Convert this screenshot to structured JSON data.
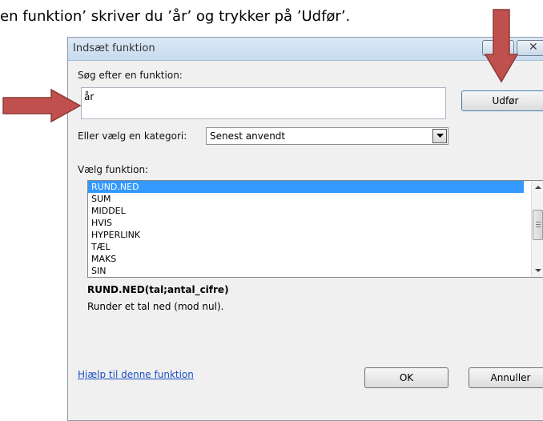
{
  "caption": "en funktion’ skriver du ’år’ og trykker på ’Udfør’.",
  "dialog": {
    "title": "Indsæt funktion",
    "search_label": "Søg efter en funktion:",
    "search_value": "år",
    "run_button": "Udfør",
    "category_label": "Eller vælg en kategori:",
    "category_value": "Senest anvendt",
    "function_list_label": "Vælg funktion:",
    "functions": [
      "RUND.NED",
      "SUM",
      "MIDDEL",
      "HVIS",
      "HYPERLINK",
      "TÆL",
      "MAKS",
      "SIN"
    ],
    "selected_function": "RUND.NED",
    "syntax": "RUND.NED(tal;antal_cifre)",
    "description": "Runder et tal ned (mod nul).",
    "help_link": "Hjælp til denne funktion",
    "ok_button": "OK",
    "cancel_button": "Annuller"
  },
  "arrows": {
    "color": "#c0504d"
  }
}
